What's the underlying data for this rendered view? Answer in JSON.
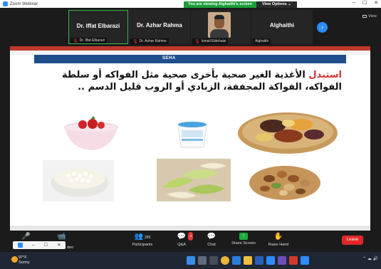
{
  "window": {
    "title": "Zoom Webinar"
  },
  "banner": {
    "message": "You are viewing Alghaithi's screen",
    "options_label": "View Options ⌄"
  },
  "participants": [
    {
      "name": "Dr. Iffat Elbarazi",
      "label": "Dr. Iffat Elbarazi",
      "muted": true,
      "active": true
    },
    {
      "name": "Dr. Azhar Rahma",
      "label": "Dr. Azhar Rahma",
      "muted": true,
      "active": false
    },
    {
      "name": "",
      "label": "Ismail Eldehaisi",
      "muted": true,
      "video": true
    },
    {
      "name": "Alghaithi",
      "label": "Alghaithi",
      "muted": false,
      "active": false
    }
  ],
  "view_label": "View",
  "slide": {
    "logo": "SEHA",
    "text_highlight": "استبدل",
    "text_rest": " الأغذية الغير صحية بأخرى صحية مثل الفواكه أو سلطة الفواكه، الفواكة المجففة، الزبادي أو الروب قليل الدسم .."
  },
  "toolbar": {
    "participants_label": "Participants",
    "participants_count": "283",
    "qa_label": "Q&A",
    "qa_badge": "4",
    "chat_label": "Chat",
    "share_label": "Share Screen",
    "raise_label": "Raise Hand",
    "leave_label": "Leave",
    "video_label": "deo"
  },
  "weather": {
    "temp": "97°F",
    "cond": "Sunny"
  },
  "colors": {
    "accent": "#2d8cff",
    "green": "#1a9e3a",
    "leave": "#e02828",
    "slide_highlight": "#d32f2f"
  }
}
